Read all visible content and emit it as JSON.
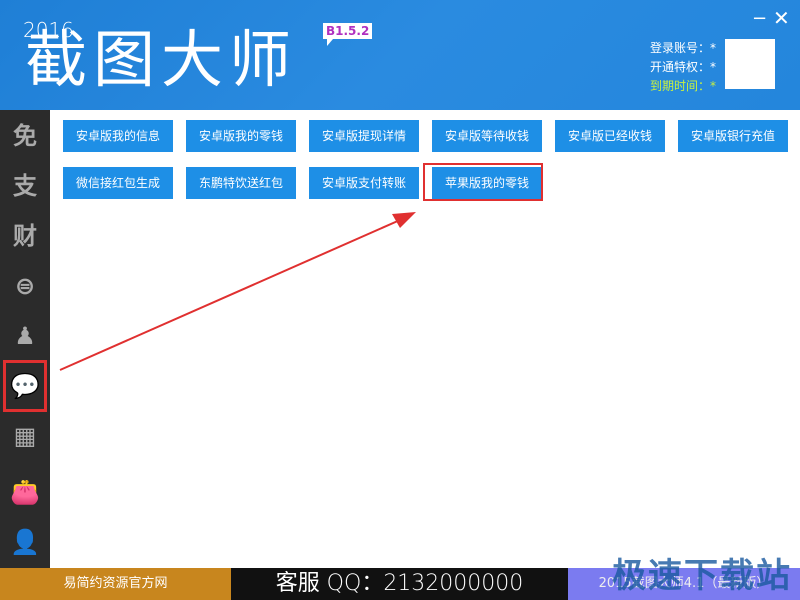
{
  "header": {
    "year": "2016",
    "title": "截图大师",
    "version": "B1.5.2",
    "account_label": "登录账号：*",
    "privilege_label": "开通特权：*",
    "expire_label": "到期时间：*",
    "minimize": "−",
    "close": "✕"
  },
  "sidebar": {
    "items": [
      {
        "icon": "免",
        "name": "free"
      },
      {
        "icon": "支",
        "name": "alipay"
      },
      {
        "icon": "财",
        "name": "finance"
      },
      {
        "icon": "⊜",
        "name": "icbc"
      },
      {
        "icon": "♟",
        "name": "qq"
      },
      {
        "icon": "💬",
        "name": "wechat",
        "selected": true
      },
      {
        "icon": "▦",
        "name": "grid"
      },
      {
        "icon": "👛",
        "name": "wallet"
      },
      {
        "icon": "👤",
        "name": "user"
      }
    ]
  },
  "buttons": [
    "安卓版我的信息",
    "安卓版我的零钱",
    "安卓版提现详情",
    "安卓版等待收钱",
    "安卓版已经收钱",
    "安卓版银行充值",
    "微信接红包生成",
    "东鹏特饮送红包",
    "安卓版支付转账",
    "苹果版我的零钱"
  ],
  "footer": {
    "left": "易简约资源官方网",
    "middle": "客服 QQ：2132000000",
    "right": "2015截图大师4.1（最新版）"
  },
  "watermark": "极速下载站",
  "colors": {
    "header": "#2486dc",
    "button": "#1e8fe6",
    "highlight": "#e03030",
    "sidebar": "#2b2b2b",
    "expire": "#c8f040"
  }
}
